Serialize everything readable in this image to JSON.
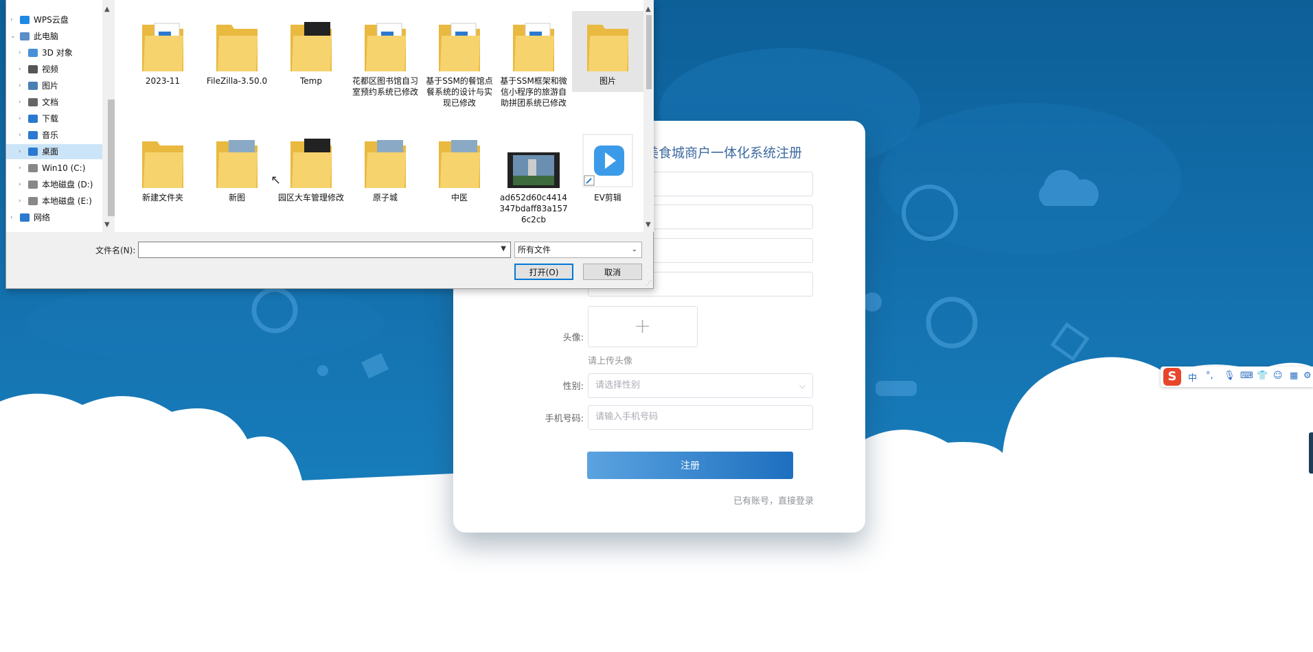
{
  "dialog": {
    "tree": [
      {
        "label": "WPS云盘",
        "icon": "cloud-icon",
        "expanded": false,
        "indent": 0
      },
      {
        "label": "此电脑",
        "icon": "computer-icon",
        "expanded": true,
        "indent": 0
      },
      {
        "label": "3D 对象",
        "icon": "3d-objects-icon",
        "indent": 1
      },
      {
        "label": "视频",
        "icon": "video-icon",
        "indent": 1
      },
      {
        "label": "图片",
        "icon": "pictures-icon",
        "indent": 1
      },
      {
        "label": "文档",
        "icon": "documents-icon",
        "indent": 1
      },
      {
        "label": "下载",
        "icon": "download-icon",
        "indent": 1
      },
      {
        "label": "音乐",
        "icon": "music-icon",
        "indent": 1
      },
      {
        "label": "桌面",
        "icon": "desktop-icon",
        "indent": 1,
        "selected": true
      },
      {
        "label": "Win10 (C:)",
        "icon": "drive-icon",
        "indent": 1
      },
      {
        "label": "本地磁盘 (D:)",
        "icon": "drive-icon",
        "indent": 1
      },
      {
        "label": "本地磁盘 (E:)",
        "icon": "drive-icon",
        "indent": 1
      },
      {
        "label": "网络",
        "icon": "network-icon",
        "indent": 0
      }
    ],
    "files": [
      {
        "name": "2023-11",
        "kind": "folder-doc"
      },
      {
        "name": "FileZilla-3.50.0",
        "kind": "folder"
      },
      {
        "name": "Temp",
        "kind": "folder-dark"
      },
      {
        "name": "花都区图书馆自习室预约系统已修改",
        "kind": "folder-doc"
      },
      {
        "name": "基于SSM的餐馆点餐系统的设计与实现已修改",
        "kind": "folder-doc"
      },
      {
        "name": "基于SSM框架和微信小程序的旅游自助拼团系统已修改",
        "kind": "folder-doc"
      },
      {
        "name": "图片",
        "kind": "folder",
        "selected": true
      },
      {
        "name": "新建文件夹",
        "kind": "folder"
      },
      {
        "name": "新图",
        "kind": "folder-photo"
      },
      {
        "name": "园区大车管理修改",
        "kind": "folder-dark"
      },
      {
        "name": "原子城",
        "kind": "folder-photo"
      },
      {
        "name": "中医",
        "kind": "folder-photo"
      },
      {
        "name": "ad652d60c4414347bdaff83a1576c2cb",
        "kind": "video"
      },
      {
        "name": "EV剪辑",
        "kind": "shortcut"
      }
    ],
    "filename_label": "文件名(N):",
    "filename_value": "",
    "filetype": "所有文件",
    "open_label": "打开(O)",
    "cancel_label": "取消"
  },
  "register": {
    "title": "美食城商户一体化系统注册",
    "avatar_label": "头像:",
    "avatar_hint": "请上传头像",
    "gender_label": "性别:",
    "gender_placeholder": "请选择性别",
    "phone_label": "手机号码:",
    "phone_placeholder": "请输入手机号码",
    "submit_label": "注册",
    "login_link": "已有账号，直接登录"
  },
  "ime": {
    "logo": "S",
    "mode": "中",
    "punct": "°,"
  },
  "colors": {
    "bg_blue": "#0f6aa6",
    "accent": "#1d6fbf",
    "ime_red": "#e8462b"
  }
}
